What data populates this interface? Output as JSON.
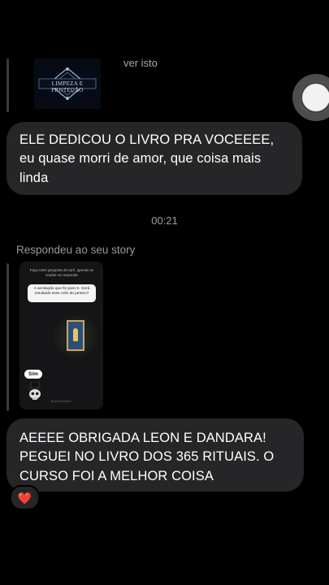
{
  "top_preview": {
    "caption": "ver isto",
    "thumbnail_text": "LIMPEZA E PROTEÇÃO"
  },
  "messages": [
    {
      "id": "msg-1",
      "text": "ELE DEDICOU O LIVRO PRA VOCEEEE, eu quase morri de amor, que coisa mais linda"
    },
    {
      "id": "msg-2",
      "text": "AEEEE OBRIGADA LEON E DANDARA! PEGUEI NO LIVRO DOS 365 RITUAIS. O CURSO FOI A MELHOR COISA"
    }
  ],
  "timestamp": "00:21",
  "reply_label": "Respondeu ao seu story",
  "story": {
    "header": "Faça UMA pergunta de tarô, apenas se souber se responde",
    "question": "A aceitação que fiz para S. Será resultado esse mês de janeiro?",
    "answer_sticker": "Sim",
    "footer": "@oshdoshdelish"
  },
  "reaction": {
    "emoji": "❤️",
    "icon": "heart-icon"
  },
  "colors": {
    "background": "#000000",
    "bubble": "#262628",
    "meta_text": "#9a9a9a",
    "heart": "#ff2d55"
  }
}
